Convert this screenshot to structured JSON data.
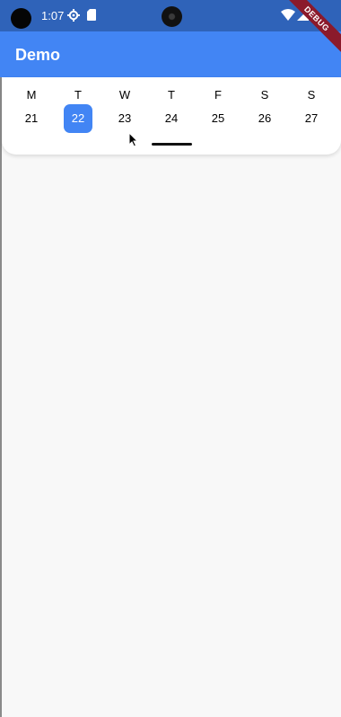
{
  "status_bar": {
    "time": "1:07",
    "icons": [
      "settings-gear-icon",
      "sd-card-icon",
      "wifi-icon",
      "cell-signal-icon"
    ]
  },
  "debug_banner": "DEBUG",
  "app_bar": {
    "title": "Demo",
    "color": "#4285f4"
  },
  "calendar": {
    "days": [
      {
        "weekday": "M",
        "date": "21",
        "selected": false
      },
      {
        "weekday": "T",
        "date": "22",
        "selected": true
      },
      {
        "weekday": "W",
        "date": "23",
        "selected": false
      },
      {
        "weekday": "T",
        "date": "24",
        "selected": false
      },
      {
        "weekday": "F",
        "date": "25",
        "selected": false
      },
      {
        "weekday": "S",
        "date": "26",
        "selected": false
      },
      {
        "weekday": "S",
        "date": "27",
        "selected": false
      }
    ],
    "accent": "#4285f4"
  }
}
